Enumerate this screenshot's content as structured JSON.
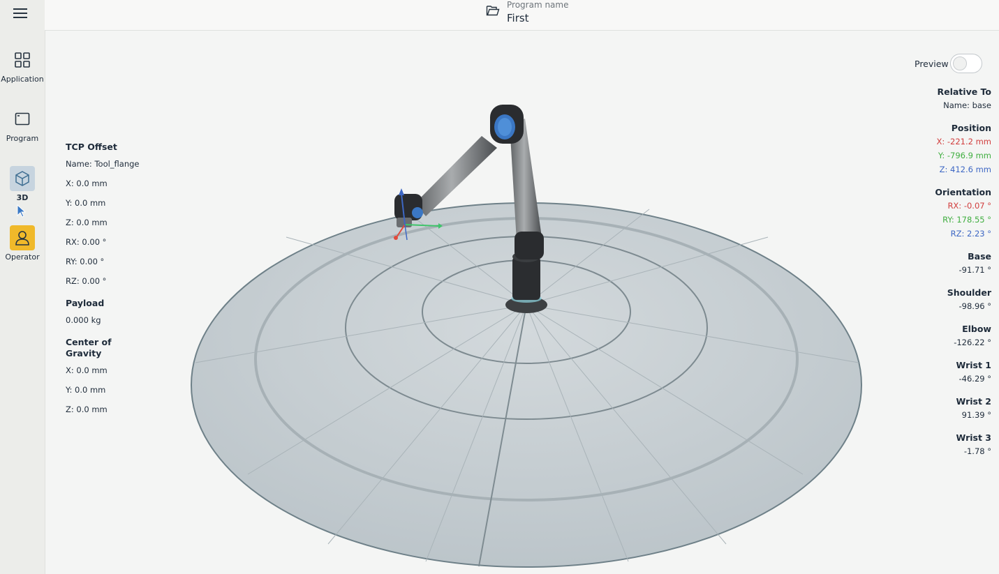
{
  "sidebar": {
    "items": [
      {
        "label": "Application",
        "icon": "grid-icon"
      },
      {
        "label": "Program",
        "icon": "window-icon"
      },
      {
        "label": "3D",
        "icon": "cube-icon",
        "active": true
      },
      {
        "label": "Operator",
        "icon": "person-icon"
      }
    ]
  },
  "header": {
    "subtitle": "Program name",
    "program_name": "First"
  },
  "preview": {
    "label": "Preview",
    "enabled": false
  },
  "tcp": {
    "title": "TCP Offset",
    "name": "Name: Tool_flange",
    "x": "X: 0.0 mm",
    "y": "Y: 0.0 mm",
    "z": "Z: 0.0 mm",
    "rx": "RX: 0.00 °",
    "ry": "RY: 0.00 °",
    "rz": "RZ: 0.00 °"
  },
  "payload": {
    "title": "Payload",
    "value": "0.000 kg"
  },
  "cog": {
    "title_line1": "Center of",
    "title_line2": "Gravity",
    "x": "X: 0.0 mm",
    "y": "Y: 0.0 mm",
    "z": "Z: 0.0 mm"
  },
  "relative": {
    "title": "Relative To",
    "name": "Name: base"
  },
  "position": {
    "title": "Position",
    "x": "X: -221.2 mm",
    "y": "Y: -796.9 mm",
    "z": "Z: 412.6 mm"
  },
  "orientation": {
    "title": "Orientation",
    "rx": "RX: -0.07 °",
    "ry": "RY: 178.55 °",
    "rz": "RZ: 2.23 °"
  },
  "joints": [
    {
      "name": "Base",
      "value": "-91.71 °"
    },
    {
      "name": "Shoulder",
      "value": "-98.96 °"
    },
    {
      "name": "Elbow",
      "value": "-126.22 °"
    },
    {
      "name": "Wrist 1",
      "value": "-46.29 °"
    },
    {
      "name": "Wrist 2",
      "value": "91.39 °"
    },
    {
      "name": "Wrist 3",
      "value": "-1.78 °"
    }
  ],
  "colors": {
    "x_axis": "#d13d3d",
    "y_axis": "#3fae3f",
    "z_axis": "#3d67c4",
    "operator_accent": "#f0b92a"
  }
}
